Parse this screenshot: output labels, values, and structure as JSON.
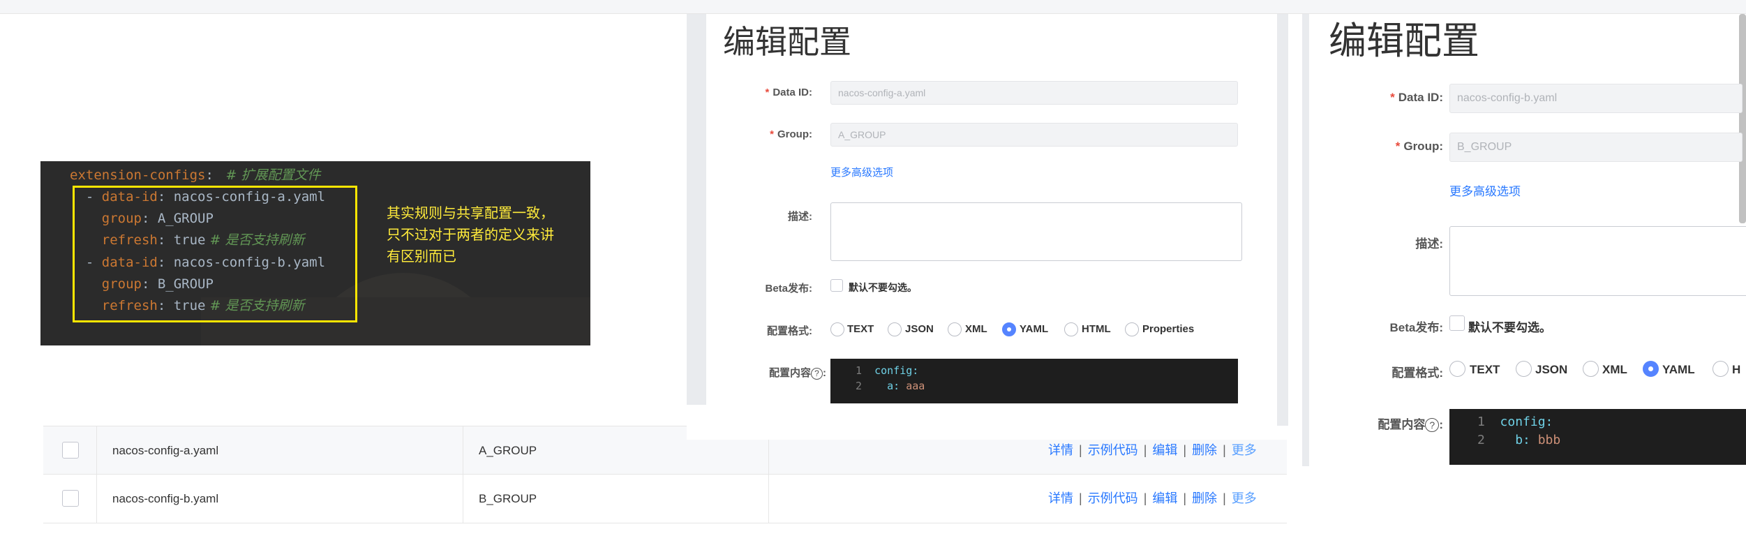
{
  "code_snippet": {
    "lines": [
      {
        "indent": "",
        "dash": "",
        "key": "extension-configs",
        "sep": ": ",
        "value": "",
        "comment": " # 扩展配置文件"
      },
      {
        "indent": "  ",
        "dash": "- ",
        "key": "data-id",
        "sep": ": ",
        "value": "nacos-config-a.yaml",
        "comment": ""
      },
      {
        "indent": "    ",
        "dash": "",
        "key": "group",
        "sep": ": ",
        "value": "A_GROUP",
        "comment": ""
      },
      {
        "indent": "    ",
        "dash": "",
        "key": "refresh",
        "sep": ": ",
        "value": "true",
        "comment": " # 是否支持刷新"
      },
      {
        "indent": "  ",
        "dash": "- ",
        "key": "data-id",
        "sep": ": ",
        "value": "nacos-config-b.yaml",
        "comment": ""
      },
      {
        "indent": "    ",
        "dash": "",
        "key": "group",
        "sep": ": ",
        "value": "B_GROUP",
        "comment": ""
      },
      {
        "indent": "    ",
        "dash": "",
        "key": "refresh",
        "sep": ": ",
        "value": "true",
        "comment": " # 是否支持刷新"
      }
    ],
    "note_lines": [
      "其实规则与共享配置一致，",
      "只不过对于两者的定义来讲",
      "有区别而已"
    ]
  },
  "config_table": {
    "rows": [
      {
        "data_id": "nacos-config-a.yaml",
        "group": "A_GROUP"
      },
      {
        "data_id": "nacos-config-b.yaml",
        "group": "B_GROUP"
      }
    ],
    "actions": [
      "详情",
      "示例代码",
      "编辑",
      "删除",
      "更多"
    ],
    "separator": "|"
  },
  "edit_dialog_a": {
    "title": "编辑配置",
    "data_id_label": "Data ID:",
    "data_id_value": "nacos-config-a.yaml",
    "group_label": "Group:",
    "group_value": "A_GROUP",
    "advanced_link": "更多高级选项",
    "description_label": "描述:",
    "beta_label": "Beta发布:",
    "beta_checkbox_label": "默认不要勾选。",
    "format_label": "配置格式:",
    "formats": [
      "TEXT",
      "JSON",
      "XML",
      "YAML",
      "HTML",
      "Properties"
    ],
    "selected_format": "YAML",
    "content_label": "配置内容",
    "help_glyph": "?",
    "editor_lines": [
      {
        "num": "1",
        "key": "config:",
        "value": ""
      },
      {
        "num": "2",
        "key": "  a: ",
        "value": "aaa"
      }
    ]
  },
  "edit_dialog_b": {
    "title": "编辑配置",
    "data_id_label": "Data ID:",
    "data_id_value": "nacos-config-b.yaml",
    "group_label": "Group:",
    "group_value": "B_GROUP",
    "advanced_link": "更多高级选项",
    "description_label": "描述:",
    "beta_label": "Beta发布:",
    "beta_checkbox_label": "默认不要勾选。",
    "format_label": "配置格式:",
    "formats": [
      "TEXT",
      "JSON",
      "XML",
      "YAML",
      "H"
    ],
    "selected_format": "YAML",
    "content_label": "配置内容",
    "help_glyph": "?",
    "editor_lines": [
      {
        "num": "1",
        "key": "config:",
        "value": ""
      },
      {
        "num": "2",
        "key": "  b: ",
        "value": "bbb"
      }
    ]
  },
  "colors": {
    "link": "#2878ff",
    "radio_selected": "#5584ff",
    "required_star": "#e84a3c",
    "note_text": "#ffeb3b",
    "highlight_border": "#ffe600"
  }
}
